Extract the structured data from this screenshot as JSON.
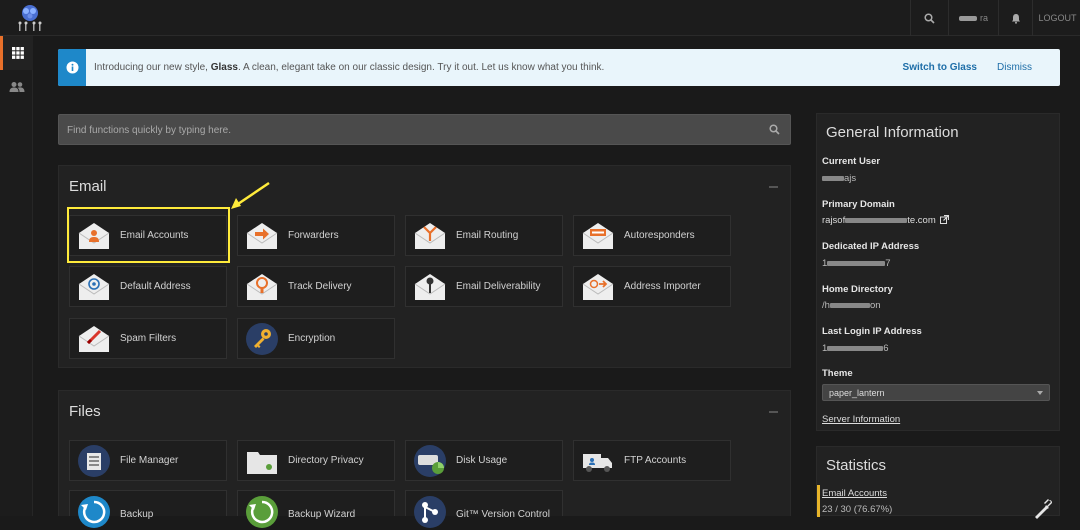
{
  "topbar": {
    "logout_label": "LOGOUT",
    "user_suffix": "ra"
  },
  "banner": {
    "text_before": "Introducing our new style,",
    "text_bold": "Glass",
    "text_after": ". A clean, elegant take on our classic design. Try it out. Let us know what you think.",
    "switch_label": "Switch to Glass",
    "dismiss_label": "Dismiss"
  },
  "search": {
    "placeholder": "Find functions quickly by typing here."
  },
  "email": {
    "title": "Email",
    "tiles": [
      "Email Accounts",
      "Forwarders",
      "Email Routing",
      "Autoresponders",
      "Default Address",
      "Track Delivery",
      "Email Deliverability",
      "Address Importer",
      "Spam Filters",
      "Encryption"
    ]
  },
  "files": {
    "title": "Files",
    "tiles": [
      "File Manager",
      "Directory Privacy",
      "Disk Usage",
      "FTP Accounts",
      "Backup",
      "Backup Wizard",
      "Git™ Version Control"
    ]
  },
  "general_info": {
    "title": "General Information",
    "current_user_label": "Current User",
    "current_user_suffix": "ajs",
    "primary_domain_label": "Primary Domain",
    "domain_prefix": "rajsof",
    "domain_suffix": "te.com",
    "dedicated_ip_label": "Dedicated IP Address",
    "dedicated_ip_prefix": "1",
    "dedicated_ip_suffix": "7",
    "home_dir_label": "Home Directory",
    "home_dir_prefix": "/h",
    "home_dir_suffix": "on",
    "last_login_label": "Last Login IP Address",
    "last_login_prefix": "1",
    "last_login_suffix": "6",
    "theme_label": "Theme",
    "theme_value": "paper_lantern",
    "server_info_link": "Server Information"
  },
  "statistics": {
    "title": "Statistics",
    "email_accounts_link": "Email Accounts",
    "email_accounts_value": "23 / 30",
    "email_accounts_pct": "(76.67%)"
  },
  "colors": {
    "accent": "#e8702a",
    "highlight": "#ffeb3b",
    "info_blue": "#1e88c9"
  }
}
